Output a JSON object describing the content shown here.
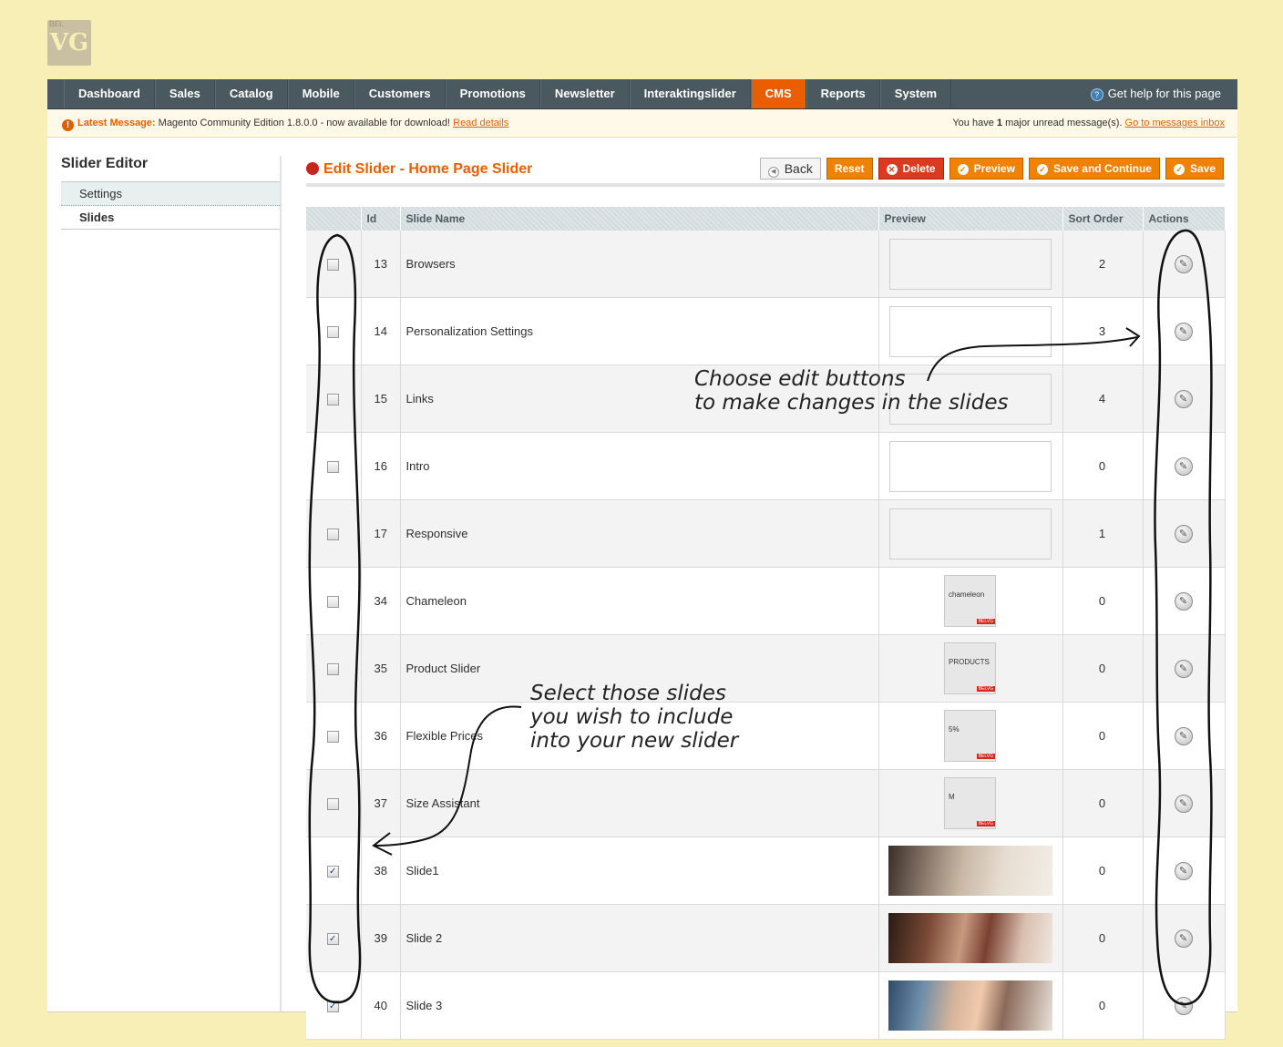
{
  "logo": {
    "small_text": "BEL",
    "mark": "VG"
  },
  "nav": {
    "items": [
      "Dashboard",
      "Sales",
      "Catalog",
      "Mobile",
      "Customers",
      "Promotions",
      "Newsletter",
      "Interaktingslider",
      "CMS",
      "Reports",
      "System"
    ],
    "active": "CMS",
    "help": "Get help for this page"
  },
  "message": {
    "latest_label": "Latest Message:",
    "text": "Magento Community Edition 1.8.0.0 - now available for download!",
    "link": "Read details",
    "right_prefix": "You have",
    "right_count": "1",
    "right_suffix": "major unread message(s).",
    "right_link": "Go to messages inbox"
  },
  "sidebar": {
    "title": "Slider Editor",
    "tabs": [
      "Settings",
      "Slides"
    ]
  },
  "page_title": "Edit Slider - Home Page Slider",
  "buttons": {
    "back": "Back",
    "reset": "Reset",
    "delete": "Delete",
    "preview": "Preview",
    "save_continue": "Save and Continue",
    "save": "Save"
  },
  "grid": {
    "columns": [
      "Id",
      "Slide Name",
      "Preview",
      "Sort Order",
      "Actions"
    ],
    "rows": [
      {
        "checked": false,
        "id": "13",
        "name": "Browsers",
        "preview": "empty",
        "sort": "2"
      },
      {
        "checked": false,
        "id": "14",
        "name": "Personalization Settings",
        "preview": "empty",
        "sort": "3"
      },
      {
        "checked": false,
        "id": "15",
        "name": "Links",
        "preview": "empty",
        "sort": "4"
      },
      {
        "checked": false,
        "id": "16",
        "name": "Intro",
        "preview": "empty",
        "sort": "0"
      },
      {
        "checked": false,
        "id": "17",
        "name": "Responsive",
        "preview": "empty",
        "sort": "1"
      },
      {
        "checked": false,
        "id": "34",
        "name": "Chameleon",
        "preview": "thumb",
        "thumb_label": "chameleon",
        "sort": "0"
      },
      {
        "checked": false,
        "id": "35",
        "name": "Product Slider",
        "preview": "thumb",
        "thumb_label": "PRODUCTS",
        "sort": "0"
      },
      {
        "checked": false,
        "id": "36",
        "name": "Flexible Prices",
        "preview": "thumb",
        "thumb_label": "5%",
        "sort": "0"
      },
      {
        "checked": false,
        "id": "37",
        "name": "Size Assistant",
        "preview": "thumb",
        "thumb_label": "M",
        "sort": "0"
      },
      {
        "checked": true,
        "id": "38",
        "name": "Slide1",
        "preview": "photo",
        "sort": "0"
      },
      {
        "checked": true,
        "id": "39",
        "name": "Slide 2",
        "preview": "photo",
        "sort": "0"
      },
      {
        "checked": true,
        "id": "40",
        "name": "Slide 3",
        "preview": "photo",
        "sort": "0"
      }
    ],
    "thumb_tag": "BELVG"
  },
  "annotations": {
    "edit_note": "Choose edit buttons\nto make changes in the slides",
    "select_note": "Select those slides\nyou wish to include\ninto your new slider"
  },
  "colors": {
    "accent": "#eb5e00",
    "nav_bg": "#4a5960",
    "page_bg": "#f8efb6"
  }
}
